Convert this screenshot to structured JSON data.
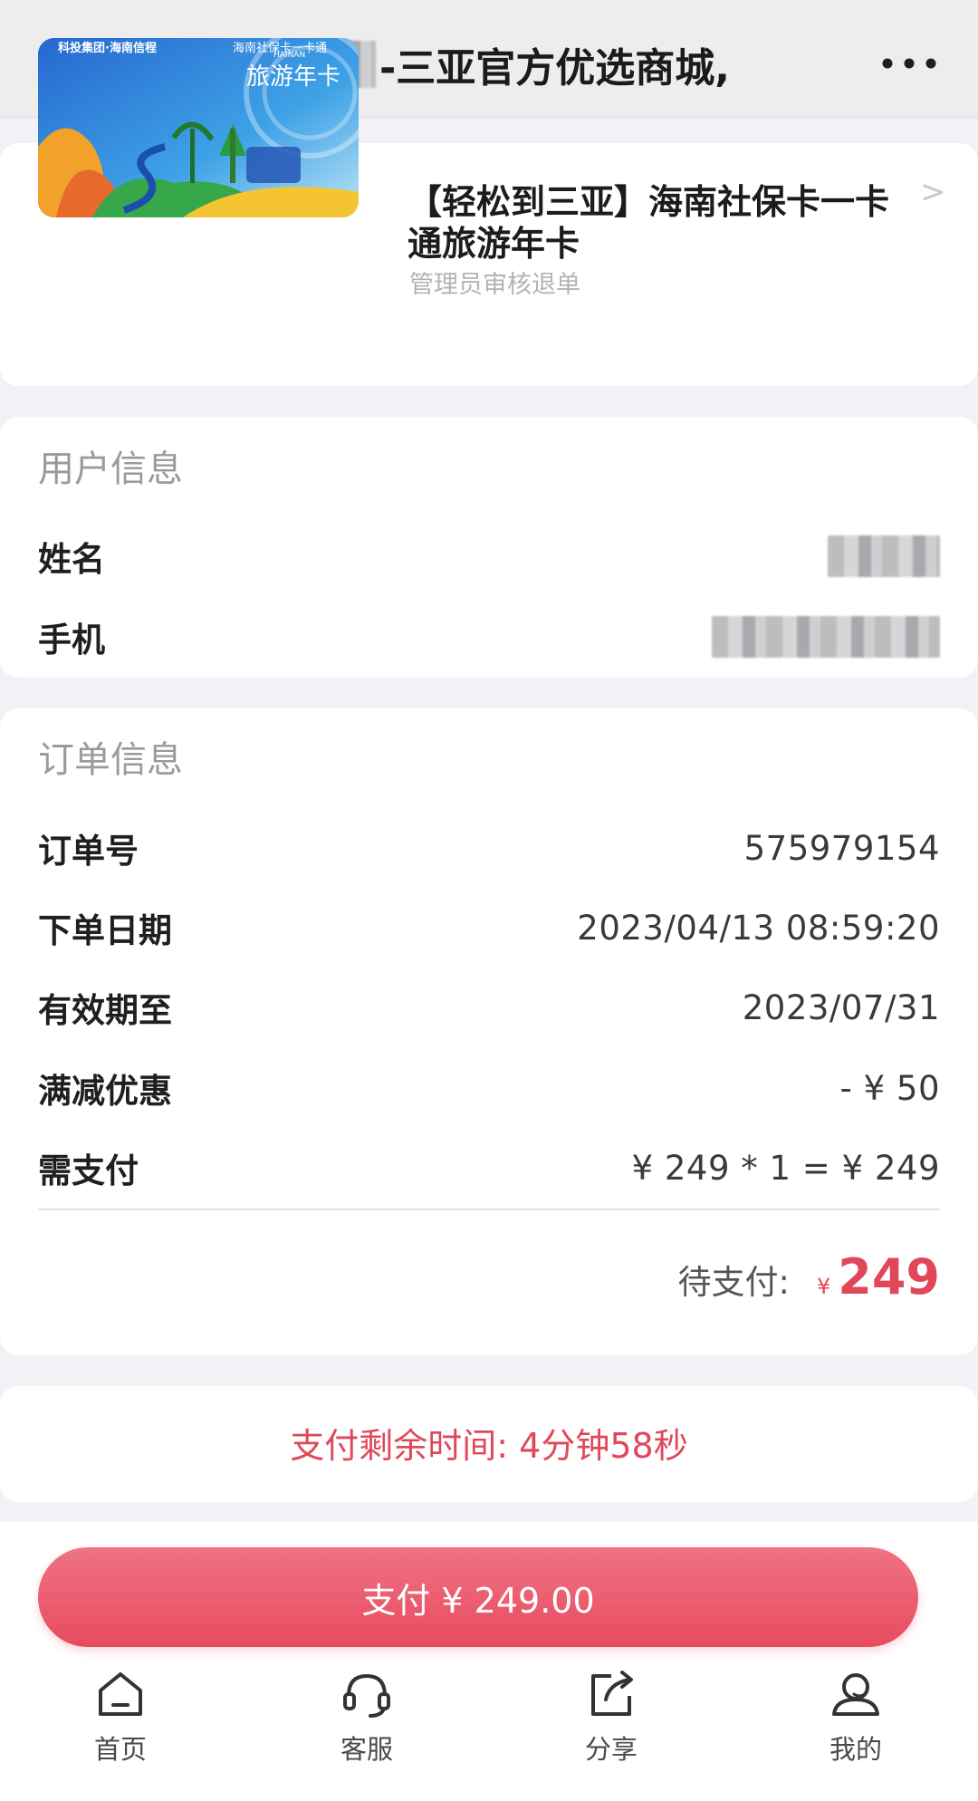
{
  "header": {
    "title": "-三亚官方优选商城,"
  },
  "product": {
    "title": "【轻松到三亚】海南社保卡一卡通旅游年卡",
    "status": "管理员审核退单",
    "chevron": ">",
    "image_header_left": "科投集团·海南信程",
    "image_header_right": "海南社保卡一卡通",
    "image_brand": "旅游年卡",
    "image_brand_en": "HAINAN"
  },
  "user_info": {
    "section_title": "用户信息",
    "name_label": "姓名",
    "phone_label": "手机"
  },
  "order_info": {
    "section_title": "订单信息",
    "rows": [
      {
        "label": "订单号",
        "value": "575979154"
      },
      {
        "label": "下单日期",
        "value": "2023/04/13 08:59:20"
      },
      {
        "label": "有效期至",
        "value": "2023/07/31"
      },
      {
        "label": "满减优惠",
        "value": "- ¥ 50"
      },
      {
        "label": "需支付",
        "value": "¥ 249 * 1 = ¥ 249"
      }
    ],
    "pending_label": "待支付:",
    "pending_symbol": "¥",
    "pending_amount": "249"
  },
  "timer": {
    "text": "支付剩余时间: 4分钟58秒"
  },
  "pay_button": {
    "label": "支付 ¥ 249.00"
  },
  "nav": {
    "home": "首页",
    "service": "客服",
    "share": "分享",
    "mine": "我的"
  },
  "colors": {
    "accent": "#e84a5e",
    "background": "#f1f1f6"
  }
}
